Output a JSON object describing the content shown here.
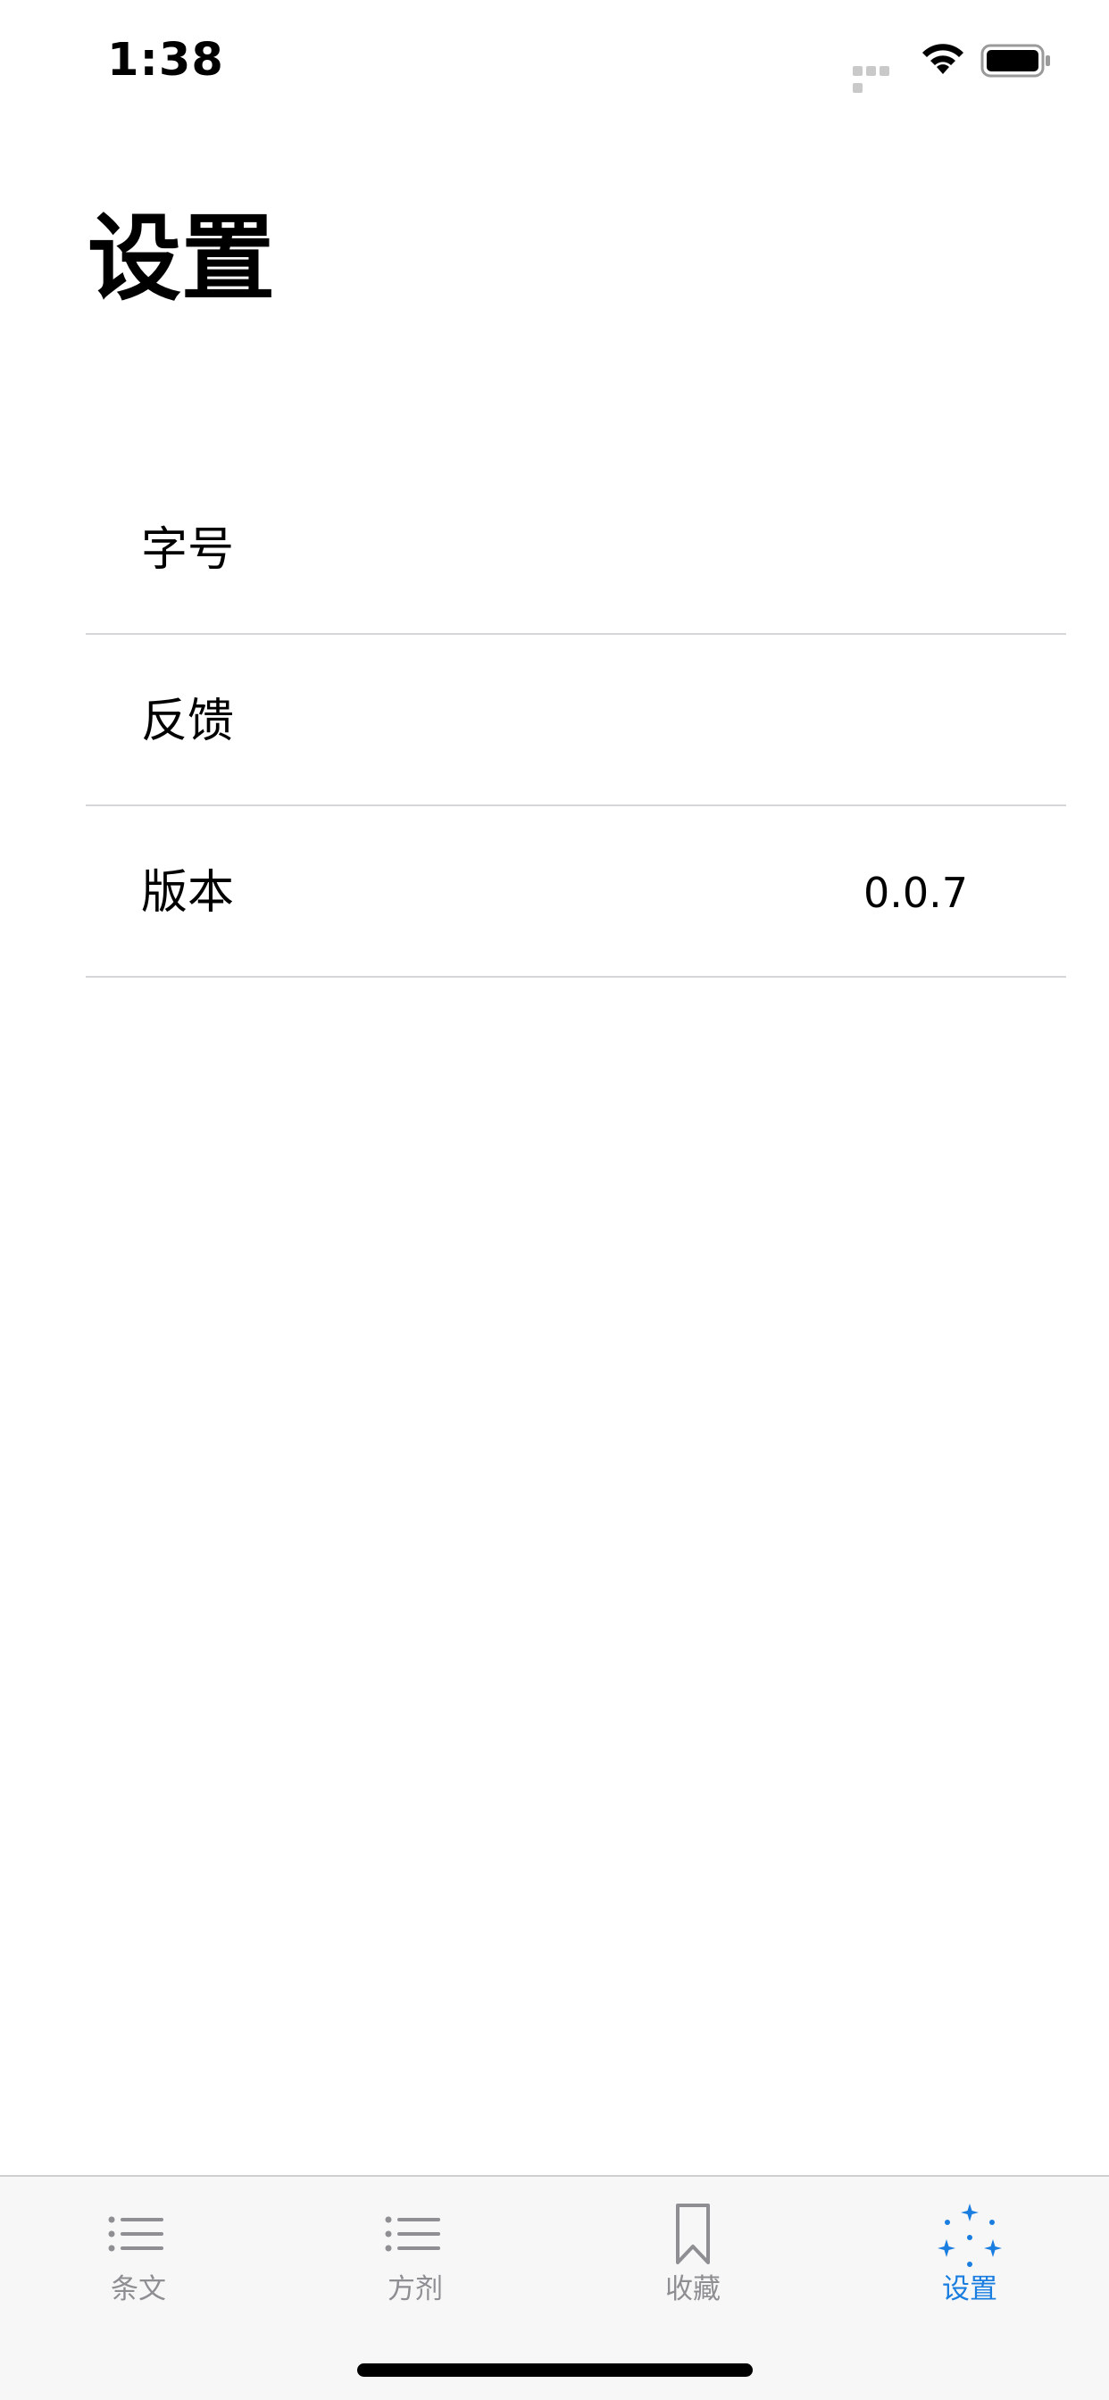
{
  "status_bar": {
    "time": "1:38",
    "signal_icon": "signal-icon",
    "wifi_icon": "wifi-icon",
    "battery_icon": "battery-icon"
  },
  "page": {
    "title": "设置"
  },
  "settings": {
    "rows": [
      {
        "label": "字号",
        "value": ""
      },
      {
        "label": "反馈",
        "value": ""
      },
      {
        "label": "版本",
        "value": "0.0.7"
      }
    ]
  },
  "tab_bar": {
    "tabs": [
      {
        "label": "条文",
        "icon": "list-icon",
        "active": false
      },
      {
        "label": "方剂",
        "icon": "list-icon",
        "active": false
      },
      {
        "label": "收藏",
        "icon": "bookmark-icon",
        "active": false
      },
      {
        "label": "设置",
        "icon": "sparkles-icon",
        "active": true
      }
    ],
    "active_color": "#1a7de0",
    "inactive_color": "#8e8e93"
  }
}
